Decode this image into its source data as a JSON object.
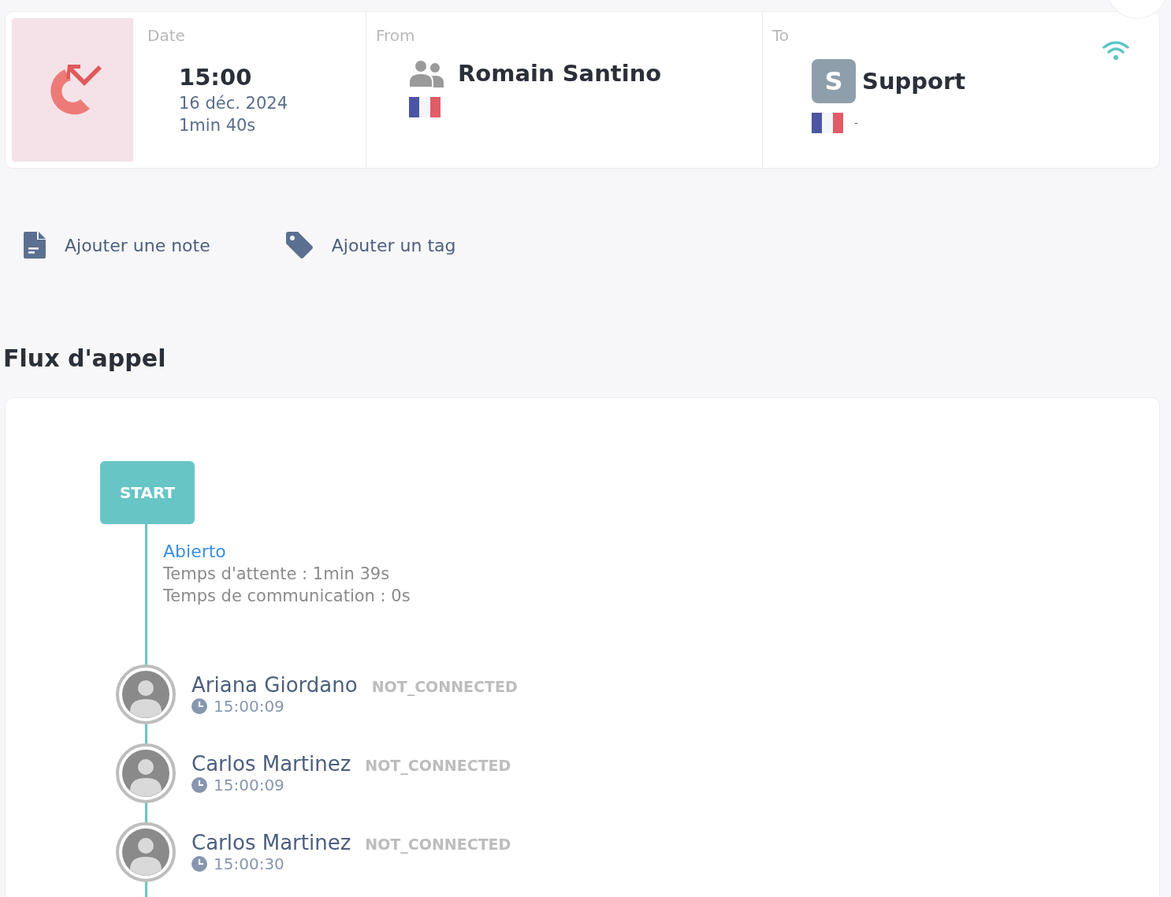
{
  "header": {
    "date": {
      "label": "Date",
      "time": "15:00",
      "day": "16 déc. 2024",
      "duration": "1min 40s"
    },
    "from": {
      "label": "From",
      "name": "Romain Santino"
    },
    "to": {
      "label": "To",
      "avatar_letter": "S",
      "name": "Support",
      "number": "-"
    }
  },
  "actions": [
    {
      "kind": "note",
      "label": "Ajouter une note"
    },
    {
      "kind": "tag",
      "label": "Ajouter un tag"
    }
  ],
  "flow": {
    "title": "Flux d'appel",
    "start_label": "START",
    "queue": {
      "name": "Abierto",
      "wait": "Temps d'attente : 1min 39s",
      "talk": "Temps de communication : 0s"
    },
    "agents": [
      {
        "name": "Ariana Giordano",
        "status": "NOT_CONNECTED",
        "time": "15:00:09"
      },
      {
        "name": "Carlos Martinez",
        "status": "NOT_CONNECTED",
        "time": "15:00:09"
      },
      {
        "name": "Carlos Martinez",
        "status": "NOT_CONNECTED",
        "time": "15:00:30"
      }
    ]
  }
}
